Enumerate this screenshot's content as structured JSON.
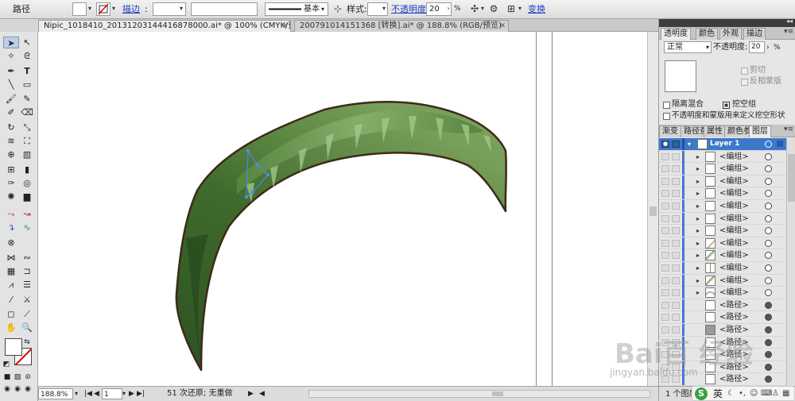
{
  "control_bar": {
    "object_type": "路径",
    "stroke_link": "描边",
    "stroke_weight": "",
    "brush_label": "基本",
    "style_label": "样式:",
    "opacity_link": "不透明度:",
    "opacity_value": "20",
    "opacity_unit": "%",
    "transform_link": "变换"
  },
  "document_tabs": [
    {
      "title": "Nipic_1018410_20131203144416878000.ai* @ 100% (CMYK/预览)",
      "active": true
    },
    {
      "title": "200791014151368 [转换].ai* @ 188.8% (RGB/预览)",
      "active": false
    }
  ],
  "tools": [
    "selection-tool",
    "direct-selection-tool",
    "magic-wand-tool",
    "lasso-tool",
    "pen-tool",
    "type-tool",
    "line-tool",
    "rectangle-tool",
    "paintbrush-tool",
    "pencil-tool",
    "blob-brush-tool",
    "eraser-tool",
    "rotate-tool",
    "scale-tool",
    "warp-tool",
    "free-transform-tool",
    "shape-builder-tool",
    "perspective-grid-tool",
    "mesh-tool",
    "gradient-tool",
    "eyedropper-tool",
    "blend-tool",
    "symbol-sprayer-tool",
    "column-graph-tool",
    "artboard-tool",
    "slice-tool",
    "hand-tool",
    "zoom-tool"
  ],
  "status_bar": {
    "zoom": "188.8%",
    "artboard_number": "1",
    "status_text": "51 次还原; 无重做"
  },
  "transparency_panel": {
    "tabs": [
      "透明度",
      "颜色",
      "外观",
      "描边"
    ],
    "blend_mode": "正常",
    "opacity_label": "不透明度:",
    "opacity_value": "20",
    "opacity_unit": "%",
    "clip_label": "剪切",
    "invert_mask_label": "反相蒙版",
    "isolate_blend_label": "隔离混合",
    "knockout_group_label": "挖空组",
    "opacity_mask_label": "不透明度和蒙版用来定义挖空形状"
  },
  "layers_panel": {
    "tabs": [
      "渐变",
      "路径查",
      "属性",
      "颜色参",
      "图层"
    ],
    "layer_name": "Layer 1",
    "items": [
      "<编组>",
      "<编组>",
      "<编组>",
      "<编组>",
      "<编组>",
      "<编组>",
      "<编组>",
      "<编组>",
      "<编组>",
      "<编组>",
      "<编组>",
      "<编组>",
      "<路径>",
      "<路径>",
      "<路径>",
      "<路径>",
      "<路径>",
      "<路径>",
      "<路径>"
    ],
    "footer_text": "1 个图层"
  },
  "ime_bar": {
    "logo_letter": "S",
    "mode_text": "英"
  },
  "watermark": {
    "brand": "Bai百 经验",
    "url": "jingyan.baidu.com"
  },
  "colors": {
    "leaf_dark": "#2f5a22",
    "leaf_light": "#7ea05a",
    "leaf_outline": "#3d2a1a",
    "selection_blue": "#3c79c8",
    "path_highlight": "#4a8ae6"
  }
}
